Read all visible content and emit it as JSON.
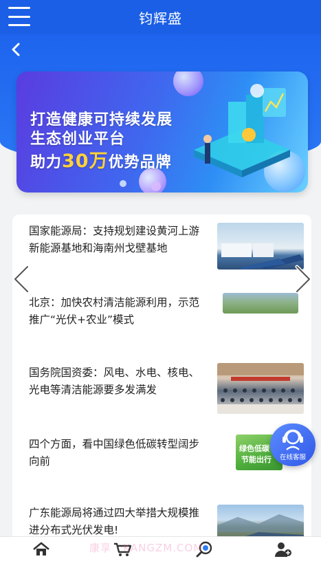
{
  "header": {
    "title": "钧辉盛",
    "menu_icon": "hamburger-menu-icon",
    "back_icon": "chevron-left-icon"
  },
  "banner": {
    "line1": "打造健康可持续发展",
    "line2": "生态创业平台",
    "line3_prefix": "助力",
    "line3_number": "30万",
    "line3_suffix": "优势品牌"
  },
  "news": [
    {
      "title": "国家能源局：支持规划建设黄河上游新能源基地和海南州戈壁基地"
    },
    {
      "title": "北京：加快农村清洁能源利用，示范推广“光伏+农业”模式"
    },
    {
      "title": "国务院国资委：风电、水电、核电、光电等清洁能源要多发满发"
    },
    {
      "title": "四个方面，看中国绿色低碳转型阔步向前",
      "thumb_text_1": "绿色低碳",
      "thumb_text_2": "节能出行"
    },
    {
      "title": "广东能源局将通过四大举措大规模推进分布式光伏发电!"
    }
  ],
  "customer_service": {
    "label": "在线客服",
    "icon": "headset-agent-icon"
  },
  "watermark": "康享 · KANGZM.COM",
  "bottom_nav": [
    {
      "icon": "home-icon"
    },
    {
      "icon": "cart-icon"
    },
    {
      "icon": "search-coin-icon"
    },
    {
      "icon": "add-user-icon"
    }
  ],
  "colors": {
    "primary": "#1b5fe6",
    "banner_highlight": "#ffd23a"
  }
}
